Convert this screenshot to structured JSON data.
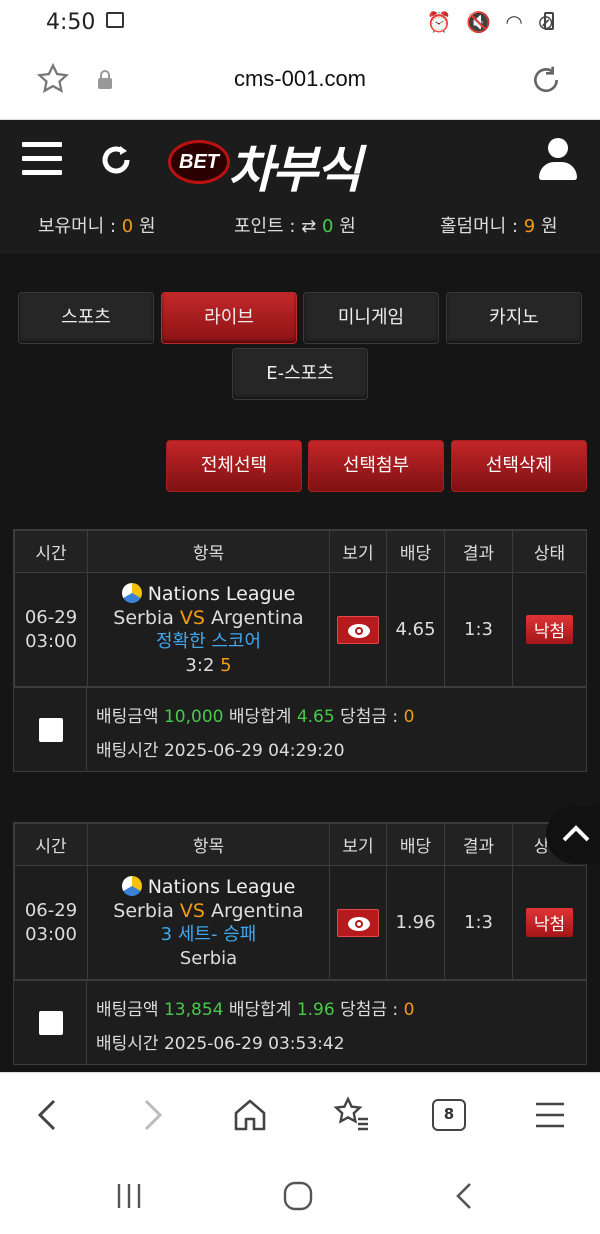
{
  "status_bar": {
    "time": "4:50"
  },
  "browser": {
    "url": "cms-001.com",
    "tab_count": "8"
  },
  "header": {
    "logo_badge": "BET",
    "logo_text": "차부식",
    "money_label": "보유머니 :",
    "money_value": "0",
    "money_unit": "원",
    "points_label": "포인트 :",
    "points_value": "0",
    "points_unit": "원",
    "holdem_label": "홀덤머니 :",
    "holdem_value": "9",
    "holdem_unit": "원"
  },
  "tabs": [
    "스포츠",
    "라이브",
    "미니게임",
    "카지노",
    "E-스포츠"
  ],
  "actions": [
    "전체선택",
    "선택첨부",
    "선택삭제"
  ],
  "table_headers": [
    "시간",
    "항목",
    "보기",
    "배당",
    "결과",
    "상태"
  ],
  "bets": [
    {
      "date": "06-29",
      "time": "03:00",
      "league": "Nations League",
      "home": "Serbia",
      "vs": "VS",
      "away": "Argentina",
      "market": "정확한 스코어",
      "pick": "3:2",
      "pick_odds": "5",
      "odds": "4.65",
      "result": "1:3",
      "status": "낙첨",
      "stake_label": "배팅금액",
      "stake": "10,000",
      "total_odds_label": "배당합계",
      "total_odds": "4.65",
      "win_label": "당첨금 :",
      "win": "0",
      "bet_time_label": "배팅시간",
      "bet_time": "2025-06-29 04:29:20"
    },
    {
      "date": "06-29",
      "time": "03:00",
      "league": "Nations League",
      "home": "Serbia",
      "vs": "VS",
      "away": "Argentina",
      "market": "3 세트- 승패",
      "pick": "Serbia",
      "pick_odds": "",
      "odds": "1.96",
      "result": "1:3",
      "status": "낙첨",
      "stake_label": "배팅금액",
      "stake": "13,854",
      "total_odds_label": "배당합계",
      "total_odds": "1.96",
      "win_label": "당첨금 :",
      "win": "0",
      "bet_time_label": "배팅시간",
      "bet_time": "2025-06-29 03:53:42"
    }
  ]
}
